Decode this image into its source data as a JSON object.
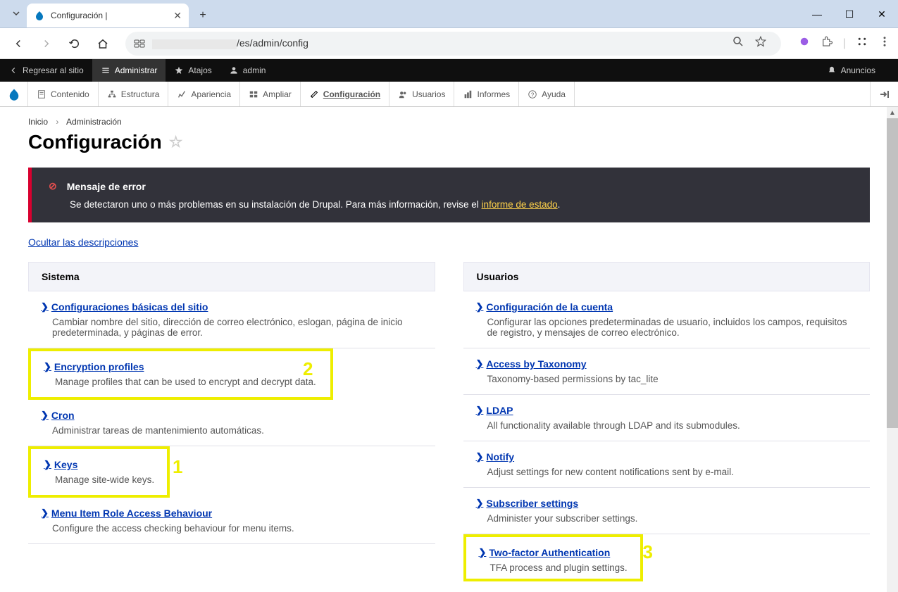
{
  "browser": {
    "tab_title": "Configuración |",
    "url_path": "/es/admin/config",
    "window": {
      "minimize": "—",
      "maximize": "☐",
      "close": "✕"
    }
  },
  "drupal_toolbar": {
    "back_to_site": "Regresar al sitio",
    "manage": "Administrar",
    "shortcuts": "Atajos",
    "user": "admin",
    "announcements": "Anuncios"
  },
  "drupal_menu": {
    "items": [
      {
        "label": "Contenido"
      },
      {
        "label": "Estructura"
      },
      {
        "label": "Apariencia"
      },
      {
        "label": "Ampliar"
      },
      {
        "label": "Configuración"
      },
      {
        "label": "Usuarios"
      },
      {
        "label": "Informes"
      },
      {
        "label": "Ayuda"
      }
    ]
  },
  "breadcrumb": {
    "home": "Inicio",
    "admin": "Administración"
  },
  "page_title": "Configuración",
  "error": {
    "title": "Mensaje de error",
    "body_pre": "Se detectaron uno o más problemas en su instalación de Drupal. Para más información, revise el ",
    "link": "informe de estado",
    "body_post": "."
  },
  "hide_descriptions": "Ocultar las descripciones",
  "panels": {
    "left": {
      "header": "Sistema",
      "items": [
        {
          "title": "Configuraciones básicas del sitio",
          "desc": "Cambiar nombre del sitio, dirección de correo electrónico, eslogan, página de inicio predeterminada, y páginas de error."
        },
        {
          "title": "Encryption profiles",
          "desc": "Manage profiles that can be used to encrypt and decrypt data."
        },
        {
          "title": "Cron",
          "desc": "Administrar tareas de mantenimiento automáticas."
        },
        {
          "title": "Keys",
          "desc": "Manage site-wide keys."
        },
        {
          "title": "Menu Item Role Access Behaviour",
          "desc": "Configure the access checking behaviour for menu items."
        }
      ]
    },
    "right": {
      "header": "Usuarios",
      "items": [
        {
          "title": "Configuración de la cuenta",
          "desc": "Configurar las opciones predeterminadas de usuario, incluidos los campos, requisitos de registro, y mensajes de correo electrónico."
        },
        {
          "title": "Access by Taxonomy",
          "desc": "Taxonomy-based permissions by tac_lite"
        },
        {
          "title": "LDAP",
          "desc": "All functionality available through LDAP and its submodules."
        },
        {
          "title": "Notify",
          "desc": "Adjust settings for new content notifications sent by e-mail."
        },
        {
          "title": "Subscriber settings",
          "desc": "Administer your subscriber settings."
        },
        {
          "title": "Two-factor Authentication",
          "desc": "TFA process and plugin settings."
        }
      ]
    }
  },
  "annotations": {
    "num1": "1",
    "num2": "2",
    "num3": "3"
  }
}
